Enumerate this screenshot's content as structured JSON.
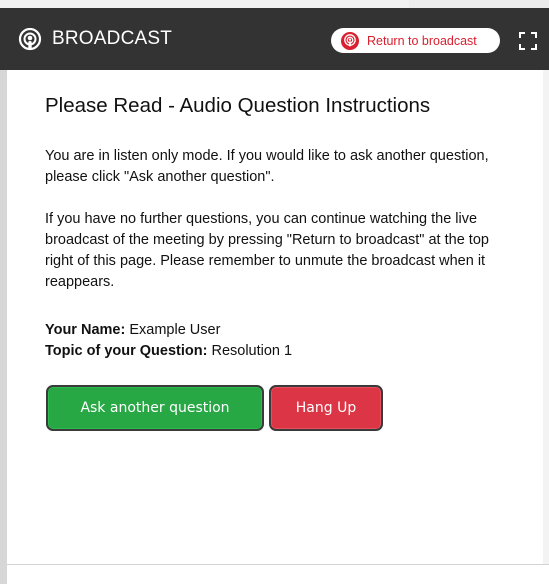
{
  "header": {
    "title": "BROADCAST",
    "brand_icon": "podcast-icon",
    "return_button_label": "Return to broadcast",
    "return_button_icon": "podcast-icon",
    "fullscreen_icon": "fullscreen-icon",
    "bg_color": "#333333",
    "accent_color": "#d9202f"
  },
  "main": {
    "title": "Please Read - Audio Question Instructions",
    "paragraph1": "You are in listen only mode. If you would like to ask another question, please click \"Ask another question\".",
    "paragraph2": "If you have no further questions, you can continue watching the live broadcast of the meeting by pressing \"Return to broadcast\" at the top right of this page. Please remember to unmute the broadcast when it reappears.",
    "name_label": "Your Name:",
    "name_value": "Example User",
    "topic_label": "Topic of your Question:",
    "topic_value": "Resolution 1"
  },
  "actions": {
    "ask_label": "Ask another question",
    "ask_color": "#28a745",
    "hangup_label": "Hang Up",
    "hangup_color": "#dc3545"
  }
}
